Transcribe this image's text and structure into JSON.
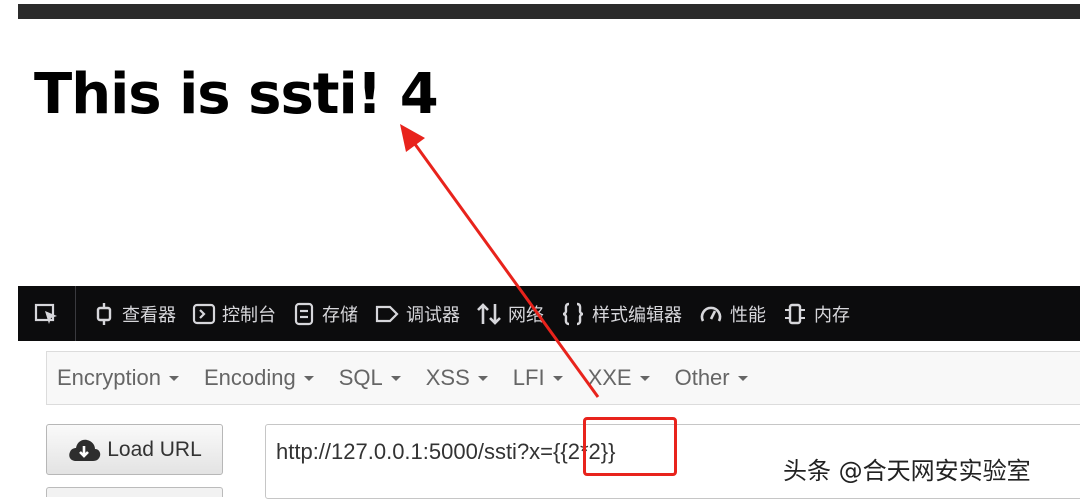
{
  "page": {
    "heading": "This is ssti! 4"
  },
  "devtools": {
    "tabs": [
      {
        "icon": "inspector-icon",
        "label": "查看器"
      },
      {
        "icon": "console-icon",
        "label": "控制台"
      },
      {
        "icon": "storage-icon",
        "label": "存储"
      },
      {
        "icon": "debugger-icon",
        "label": "调试器"
      },
      {
        "icon": "network-icon",
        "label": "网络"
      },
      {
        "icon": "style-editor-icon",
        "label": "样式编辑器"
      },
      {
        "icon": "performance-icon",
        "label": "性能"
      },
      {
        "icon": "memory-icon",
        "label": "内存"
      }
    ]
  },
  "hackbar": {
    "menus": [
      "Encryption",
      "Encoding",
      "SQL",
      "XSS",
      "LFI",
      "XXE",
      "Other"
    ],
    "load_url_label": "Load URL",
    "url_base": "http://127.0.0.1:5000/ssti?x=",
    "url_payload": "{{2*2}}"
  },
  "annotation": {
    "color": "#e8231c"
  },
  "watermark": "头条 @合天网安实验室"
}
